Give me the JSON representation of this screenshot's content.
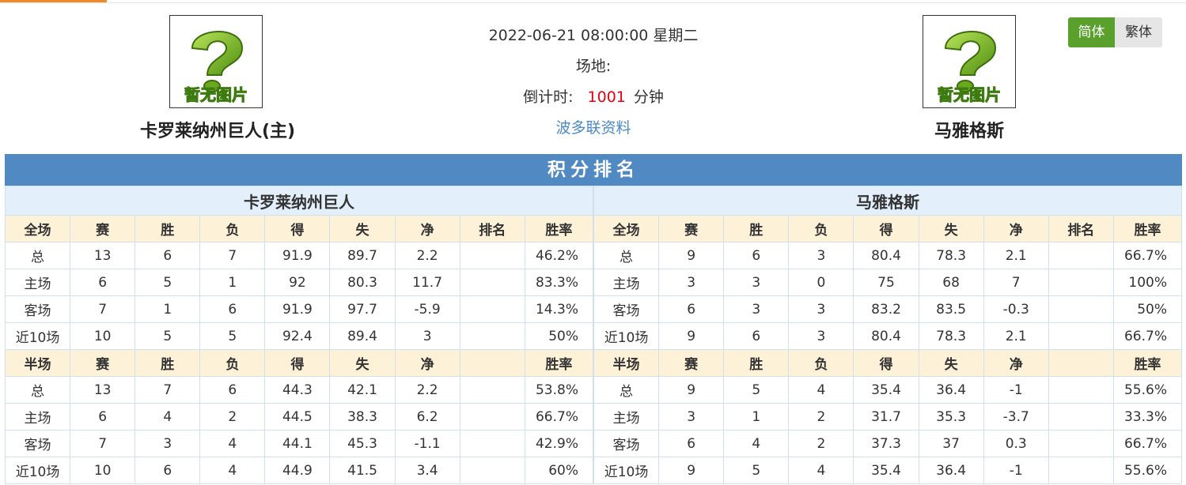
{
  "home_team": {
    "name": "卡罗莱纳州巨人(主)",
    "logo_text": "暂无图片"
  },
  "away_team": {
    "name": "马雅格斯",
    "logo_text": "暂无图片"
  },
  "match": {
    "datetime": "2022-06-21 08:00:00 星期二",
    "venue_label": "场地:",
    "countdown_label": "倒计时:",
    "countdown_value": "1001",
    "countdown_unit": "分钟",
    "link_text": "波多联资料"
  },
  "language": {
    "simplified": "简体",
    "traditional": "繁体",
    "active": "简体"
  },
  "standings": {
    "title": "积分排名",
    "columns_full": [
      "全场",
      "赛",
      "胜",
      "负",
      "得",
      "失",
      "净",
      "排名",
      "胜率"
    ],
    "columns_half": [
      "半场",
      "赛",
      "胜",
      "负",
      "得",
      "失",
      "净",
      "",
      "胜率"
    ],
    "home": {
      "team": "卡罗莱纳州巨人",
      "full": [
        [
          "总",
          "13",
          "6",
          "7",
          "91.9",
          "89.7",
          "2.2",
          "",
          "46.2%"
        ],
        [
          "主场",
          "6",
          "5",
          "1",
          "92",
          "80.3",
          "11.7",
          "",
          "83.3%"
        ],
        [
          "客场",
          "7",
          "1",
          "6",
          "91.9",
          "97.7",
          "-5.9",
          "",
          "14.3%"
        ],
        [
          "近10场",
          "10",
          "5",
          "5",
          "92.4",
          "89.4",
          "3",
          "",
          "50%"
        ]
      ],
      "half": [
        [
          "总",
          "13",
          "7",
          "6",
          "44.3",
          "42.1",
          "2.2",
          "",
          "53.8%"
        ],
        [
          "主场",
          "6",
          "4",
          "2",
          "44.5",
          "38.3",
          "6.2",
          "",
          "66.7%"
        ],
        [
          "客场",
          "7",
          "3",
          "4",
          "44.1",
          "45.3",
          "-1.1",
          "",
          "42.9%"
        ],
        [
          "近10场",
          "10",
          "6",
          "4",
          "44.9",
          "41.5",
          "3.4",
          "",
          "60%"
        ]
      ]
    },
    "away": {
      "team": "马雅格斯",
      "full": [
        [
          "总",
          "9",
          "6",
          "3",
          "80.4",
          "78.3",
          "2.1",
          "",
          "66.7%"
        ],
        [
          "主场",
          "3",
          "3",
          "0",
          "75",
          "68",
          "7",
          "",
          "100%"
        ],
        [
          "客场",
          "6",
          "3",
          "3",
          "83.2",
          "83.5",
          "-0.3",
          "",
          "50%"
        ],
        [
          "近10场",
          "9",
          "6",
          "3",
          "80.4",
          "78.3",
          "2.1",
          "",
          "66.7%"
        ]
      ],
      "half": [
        [
          "总",
          "9",
          "5",
          "4",
          "35.4",
          "36.4",
          "-1",
          "",
          "55.6%"
        ],
        [
          "主场",
          "3",
          "1",
          "2",
          "31.7",
          "35.3",
          "-3.7",
          "",
          "33.3%"
        ],
        [
          "客场",
          "6",
          "4",
          "2",
          "37.3",
          "37",
          "0.3",
          "",
          "66.7%"
        ],
        [
          "近10场",
          "9",
          "5",
          "4",
          "35.4",
          "36.4",
          "-1",
          "",
          "55.6%"
        ]
      ]
    }
  },
  "colors": {
    "accent_orange": "#f08a24",
    "title_blue": "#5189c3",
    "header_yellow": "#fdf1d8",
    "home_label_red": "#e60012",
    "lang_green": "#5aa02c",
    "link_blue": "#4a8ac6"
  }
}
